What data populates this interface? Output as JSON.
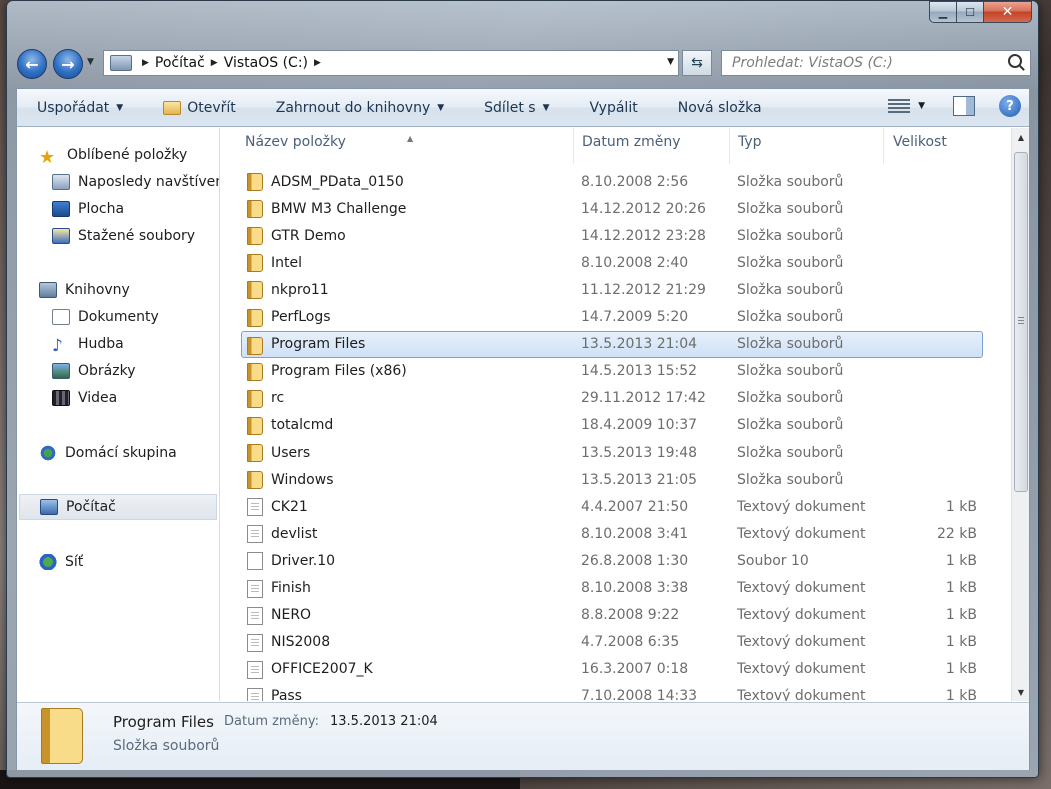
{
  "address": {
    "crumbs": [
      "Počítač",
      "VistaOS (C:)"
    ]
  },
  "search": {
    "placeholder": "Prohledat: VistaOS (C:)"
  },
  "toolbar": {
    "organize": "Uspořádat",
    "open": "Otevřít",
    "include_library": "Zahrnout do knihovny",
    "share": "Sdílet s",
    "burn": "Vypálit",
    "new_folder": "Nová složka"
  },
  "sidebar": {
    "favorites": "Oblíbené položky",
    "recent": "Naposledy navštíven",
    "desktop": "Plocha",
    "downloads": "Stažené soubory",
    "libraries": "Knihovny",
    "documents": "Dokumenty",
    "music": "Hudba",
    "pictures": "Obrázky",
    "videos": "Videa",
    "homegroup": "Domácí skupina",
    "computer": "Počítač",
    "network": "Síť"
  },
  "columns": {
    "name": "Název položky",
    "date": "Datum změny",
    "type": "Typ",
    "size": "Velikost"
  },
  "files": [
    {
      "name": "ADSM_PData_0150",
      "date": "8.10.2008 2:56",
      "type": "Složka souborů",
      "size": "",
      "kind": "folder"
    },
    {
      "name": "BMW M3 Challenge",
      "date": "14.12.2012 20:26",
      "type": "Složka souborů",
      "size": "",
      "kind": "folder"
    },
    {
      "name": "GTR Demo",
      "date": "14.12.2012 23:28",
      "type": "Složka souborů",
      "size": "",
      "kind": "folder"
    },
    {
      "name": "Intel",
      "date": "8.10.2008 2:40",
      "type": "Složka souborů",
      "size": "",
      "kind": "folder"
    },
    {
      "name": "nkpro11",
      "date": "11.12.2012 21:29",
      "type": "Složka souborů",
      "size": "",
      "kind": "folder"
    },
    {
      "name": "PerfLogs",
      "date": "14.7.2009 5:20",
      "type": "Složka souborů",
      "size": "",
      "kind": "folder"
    },
    {
      "name": "Program Files",
      "date": "13.5.2013 21:04",
      "type": "Složka souborů",
      "size": "",
      "kind": "folder",
      "selected": true
    },
    {
      "name": "Program Files (x86)",
      "date": "14.5.2013 15:52",
      "type": "Složka souborů",
      "size": "",
      "kind": "folder"
    },
    {
      "name": "rc",
      "date": "29.11.2012 17:42",
      "type": "Složka souborů",
      "size": "",
      "kind": "folder"
    },
    {
      "name": "totalcmd",
      "date": "18.4.2009 10:37",
      "type": "Složka souborů",
      "size": "",
      "kind": "folder"
    },
    {
      "name": "Users",
      "date": "13.5.2013 19:48",
      "type": "Složka souborů",
      "size": "",
      "kind": "folder"
    },
    {
      "name": "Windows",
      "date": "13.5.2013 21:05",
      "type": "Složka souborů",
      "size": "",
      "kind": "folder"
    },
    {
      "name": "CK21",
      "date": "4.4.2007 21:50",
      "type": "Textový dokument",
      "size": "1 kB",
      "kind": "text"
    },
    {
      "name": "devlist",
      "date": "8.10.2008 3:41",
      "type": "Textový dokument",
      "size": "22 kB",
      "kind": "text"
    },
    {
      "name": "Driver.10",
      "date": "26.8.2008 1:30",
      "type": "Soubor 10",
      "size": "1 kB",
      "kind": "file"
    },
    {
      "name": "Finish",
      "date": "8.10.2008 3:38",
      "type": "Textový dokument",
      "size": "1 kB",
      "kind": "text"
    },
    {
      "name": "NERO",
      "date": "8.8.2008 9:22",
      "type": "Textový dokument",
      "size": "1 kB",
      "kind": "text"
    },
    {
      "name": "NIS2008",
      "date": "4.7.2008 6:35",
      "type": "Textový dokument",
      "size": "1 kB",
      "kind": "text"
    },
    {
      "name": "OFFICE2007_K",
      "date": "16.3.2007 0:18",
      "type": "Textový dokument",
      "size": "1 kB",
      "kind": "text"
    },
    {
      "name": "Pass",
      "date": "7.10.2008 14:33",
      "type": "Textový dokument",
      "size": "1 kB",
      "kind": "text"
    }
  ],
  "details": {
    "name": "Program Files",
    "date_label": "Datum změny:",
    "date_value": "13.5.2013 21:04",
    "type": "Složka souborů"
  }
}
